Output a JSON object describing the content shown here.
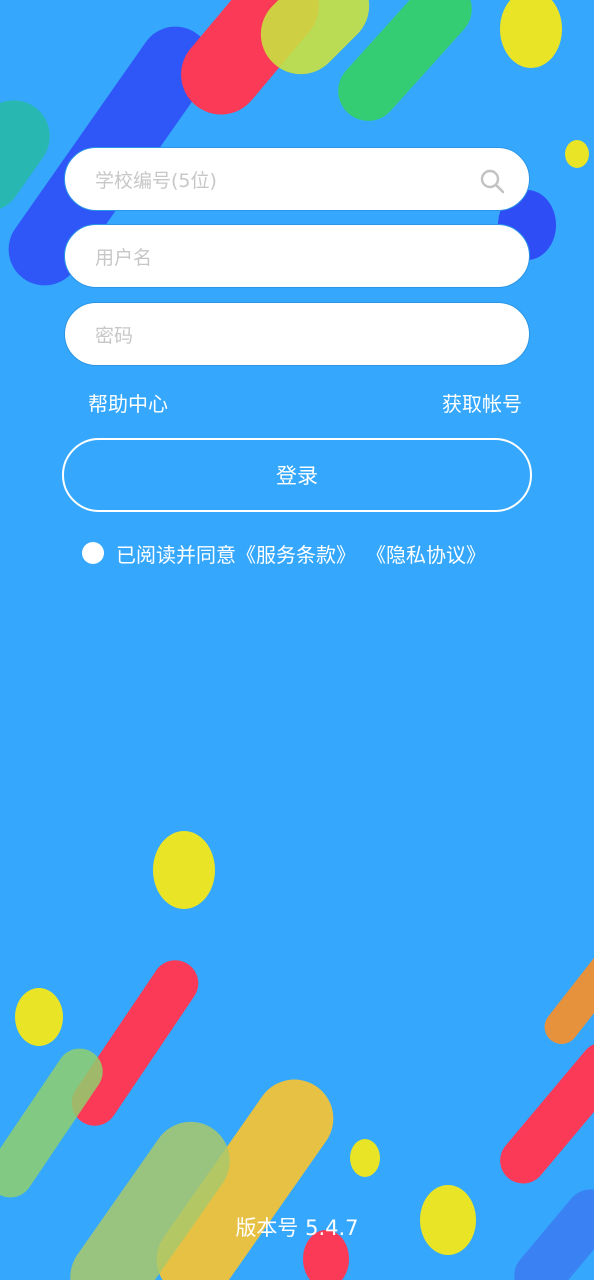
{
  "login_form": {
    "school_code_placeholder": "学校编号(5位)",
    "username_placeholder": "用户名",
    "password_placeholder": "密码",
    "search_icon": "search-icon"
  },
  "links": {
    "help_center": "帮助中心",
    "get_account": "获取帐号"
  },
  "login_button_label": "登录",
  "agreement": {
    "text": "已阅读并同意",
    "terms": "《服务条款》",
    "privacy": "《隐私协议》"
  },
  "footer": {
    "version": "版本号 5.4.7"
  },
  "colors": {
    "background": "#35a8fd",
    "yellow": "#e9e425",
    "red": "#fa3a56",
    "blue": "#2f4df5",
    "green": "#35d45c"
  }
}
